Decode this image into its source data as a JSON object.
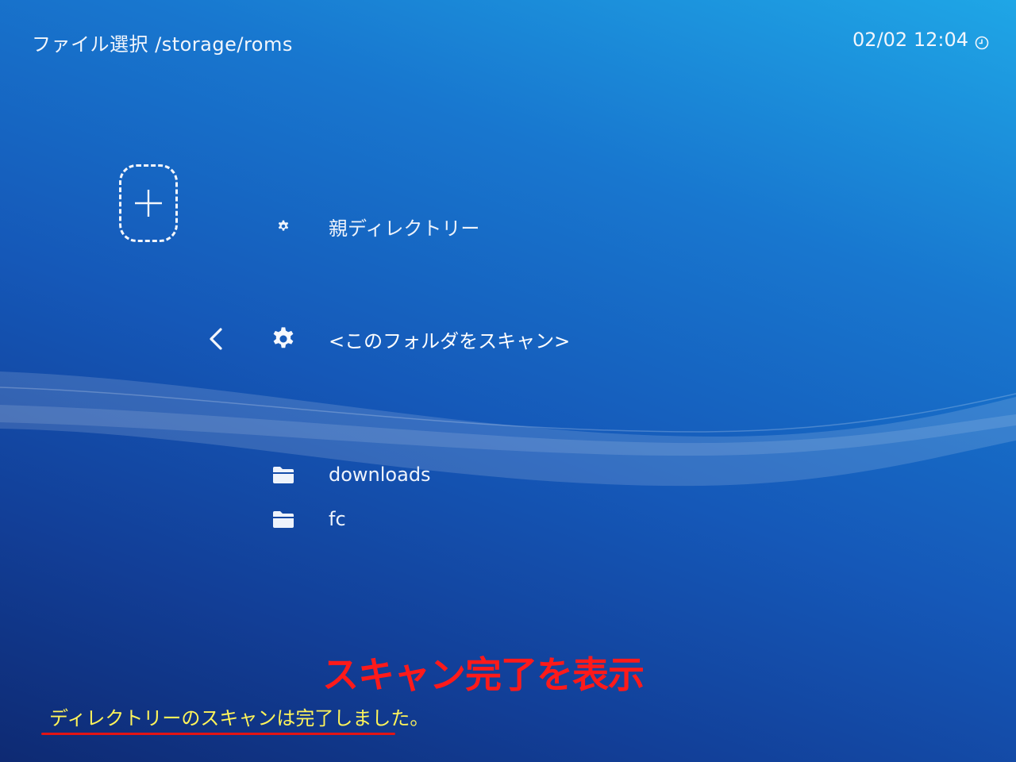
{
  "header": {
    "title": "ファイル選択 /storage/roms",
    "datetime": "02/02 12:04",
    "clock_icon": "clock-icon"
  },
  "add_tile": {
    "icon": "plus-icon"
  },
  "entries": [
    {
      "icon": "gear-icon",
      "label": "親ディレクトリー"
    },
    {
      "icon": "gear-icon",
      "label": "<このフォルダをスキャン>",
      "selected": true
    },
    {
      "icon": "folder-icon",
      "label": "downloads"
    },
    {
      "icon": "folder-icon",
      "label": "fc"
    }
  ],
  "back_icon": "chevron-left-icon",
  "annotation": {
    "text": "スキャン完了を表示",
    "color": "#ff1a1a"
  },
  "status": {
    "message": "ディレクトリーのスキャンは完了しました。",
    "color": "#fff45a",
    "underline_color": "#e31414"
  }
}
